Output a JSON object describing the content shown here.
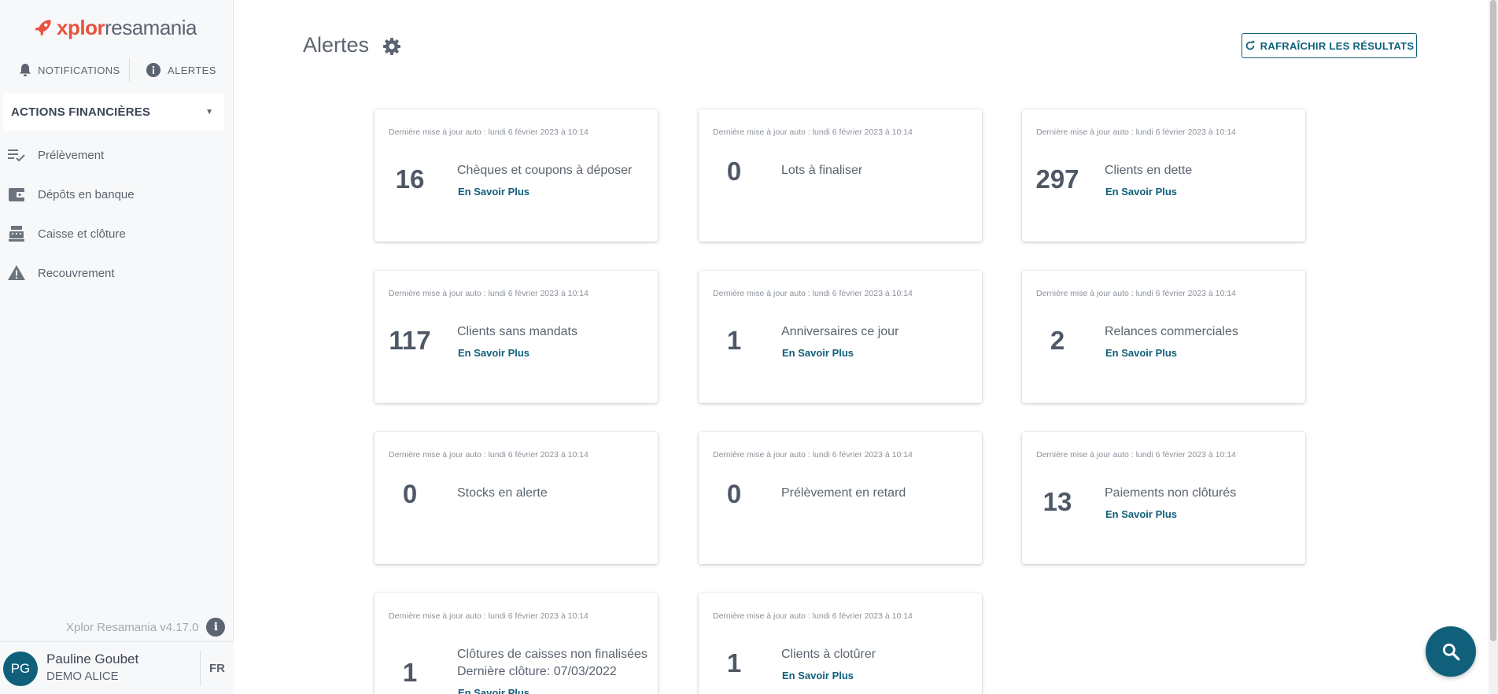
{
  "app": {
    "logo_part1": "xplor",
    "logo_part2": "resamania"
  },
  "sidebar": {
    "notifications_label": "NOTIFICATIONS",
    "alerts_label": "ALERTES",
    "section_label": "ACTIONS FINANCIÈRES",
    "items": [
      {
        "label": "Prélèvement",
        "icon": "checklist-icon"
      },
      {
        "label": "Dépôts en banque",
        "icon": "wallet-icon"
      },
      {
        "label": "Caisse et clôture",
        "icon": "cash-register-icon"
      },
      {
        "label": "Recouvrement",
        "icon": "warning-icon"
      }
    ],
    "version": "Xplor Resamania v4.17.0",
    "user": {
      "initials": "PG",
      "name": "Pauline Goubet",
      "org": "DEMO ALICE",
      "lang": "FR"
    }
  },
  "main": {
    "title": "Alertes",
    "refresh_label": "RAFRAÎCHIR LES RÉSULTATS",
    "more_label": "En Savoir Plus",
    "cards": [
      {
        "updated": "Dernière mise à jour auto : lundi 6 février 2023 à 10:14",
        "count": "16",
        "title": "Chèques et coupons à déposer",
        "more": "En Savoir Plus"
      },
      {
        "updated": "Dernière mise à jour auto : lundi 6 février 2023 à 10:14",
        "count": "0",
        "title": "Lots à finaliser"
      },
      {
        "updated": "Dernière mise à jour auto : lundi 6 février 2023 à 10:14",
        "count": "297",
        "title": "Clients en dette",
        "more": "En Savoir Plus"
      },
      {
        "updated": "Dernière mise à jour auto : lundi 6 février 2023 à 10:14",
        "count": "117",
        "title": "Clients sans mandats",
        "more": "En Savoir Plus"
      },
      {
        "updated": "Dernière mise à jour auto : lundi 6 février 2023 à 10:14",
        "count": "1",
        "title": "Anniversaires ce jour",
        "more": "En Savoir Plus"
      },
      {
        "updated": "Dernière mise à jour auto : lundi 6 février 2023 à 10:14",
        "count": "2",
        "title": "Relances commerciales",
        "more": "En Savoir Plus"
      },
      {
        "updated": "Dernière mise à jour auto : lundi 6 février 2023 à 10:14",
        "count": "0",
        "title": "Stocks en alerte"
      },
      {
        "updated": "Dernière mise à jour auto : lundi 6 février 2023 à 10:14",
        "count": "0",
        "title": "Prélèvement en retard"
      },
      {
        "updated": "Dernière mise à jour auto : lundi 6 février 2023 à 10:14",
        "count": "13",
        "title": "Paiements non clôturés",
        "more": "En Savoir Plus"
      },
      {
        "updated": "Dernière mise à jour auto : lundi 6 février 2023 à 10:14",
        "count": "1",
        "title": "Clôtures de caisses non finalisées",
        "subline": "Dernière clôture: 07/03/2022",
        "more": "En Savoir Plus"
      },
      {
        "updated": "Dernière mise à jour auto : lundi 6 février 2023 à 10:14",
        "count": "1",
        "title": "Clients à clotûrer",
        "more": "En Savoir Plus"
      }
    ]
  },
  "colors": {
    "primary": "#10607b",
    "brand_orange": "#e8523e",
    "text": "#5b6470"
  }
}
